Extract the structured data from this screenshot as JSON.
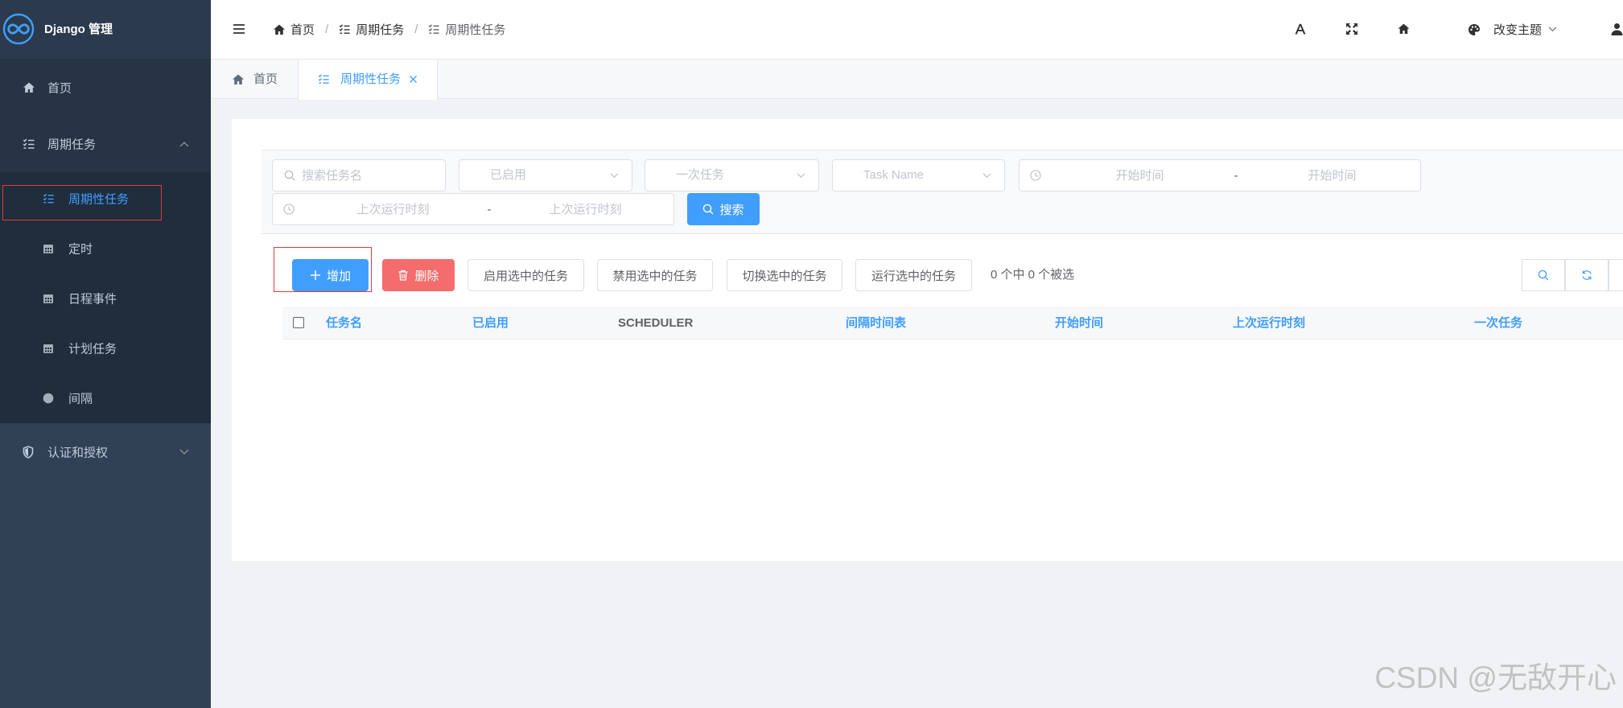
{
  "app": {
    "title": "Django 管理",
    "logo_icon": "infinity-logo-icon"
  },
  "sidebar": {
    "items": [
      {
        "label": "首页",
        "icon": "home-icon"
      },
      {
        "label": "周期任务",
        "icon": "list-check-icon",
        "expanded": true,
        "children": [
          {
            "label": "周期性任务",
            "icon": "list-check-icon",
            "active": true
          },
          {
            "label": "定时",
            "icon": "calendar-icon"
          },
          {
            "label": "日程事件",
            "icon": "calendar-icon"
          },
          {
            "label": "计划任务",
            "icon": "calendar-icon"
          },
          {
            "label": "间隔",
            "icon": "circle-icon"
          }
        ]
      },
      {
        "label": "认证和授权",
        "icon": "shield-icon",
        "expanded": false
      }
    ]
  },
  "header": {
    "menu_icon": "hamburger-icon",
    "breadcrumb": [
      {
        "label": "首页",
        "icon": "home-icon"
      },
      {
        "label": "周期任务",
        "icon": "list-check-icon"
      },
      {
        "label": "周期性任务",
        "icon": "list-check-icon"
      }
    ],
    "separator": "/",
    "tools": [
      "font-size-icon",
      "fullscreen-icon",
      "home-icon"
    ],
    "theme_label": "改变主题",
    "user_icon": "user-icon"
  },
  "tabs": [
    {
      "label": "首页",
      "icon": "home-icon",
      "active": false
    },
    {
      "label": "周期性任务",
      "icon": "list-check-icon",
      "active": true,
      "closable": true
    }
  ],
  "filters": {
    "search": {
      "placeholder": "搜索任务名"
    },
    "enabled_select": {
      "placeholder": "已启用"
    },
    "one_off_select": {
      "placeholder": "一次任务"
    },
    "task_select": {
      "placeholder": "Task Name"
    },
    "start_time_range": {
      "start_placeholder": "开始时间",
      "separator": "-",
      "end_placeholder": "开始时间"
    },
    "last_run_range": {
      "start_placeholder": "上次运行时刻",
      "separator": "-",
      "end_placeholder": "上次运行时刻"
    },
    "search_button": "搜索"
  },
  "actions": {
    "add": "增加",
    "delete": "删除",
    "enable": "启用选中的任务",
    "disable": "禁用选中的任务",
    "toggle": "切换选中的任务",
    "run": "运行选中的任务",
    "selection_count": "0 个中 0 个被选",
    "tools": [
      "search-icon",
      "refresh-icon"
    ]
  },
  "table": {
    "columns": [
      {
        "label": "任务名",
        "sortable": true
      },
      {
        "label": "已启用",
        "sortable": true
      },
      {
        "label": "SCHEDULER",
        "sortable": false
      },
      {
        "label": "间隔时间表",
        "sortable": true
      },
      {
        "label": "开始时间",
        "sortable": true
      },
      {
        "label": "上次运行时刻",
        "sortable": true
      },
      {
        "label": "一次任务",
        "sortable": true
      }
    ],
    "rows": []
  },
  "watermark": "CSDN @无敌开心",
  "colors": {
    "accent": "#409eff",
    "danger": "#f56c6c",
    "sidebar_bg": "#304156",
    "submenu_bg": "#1f2d3d",
    "highlight_box": "#e53935"
  }
}
